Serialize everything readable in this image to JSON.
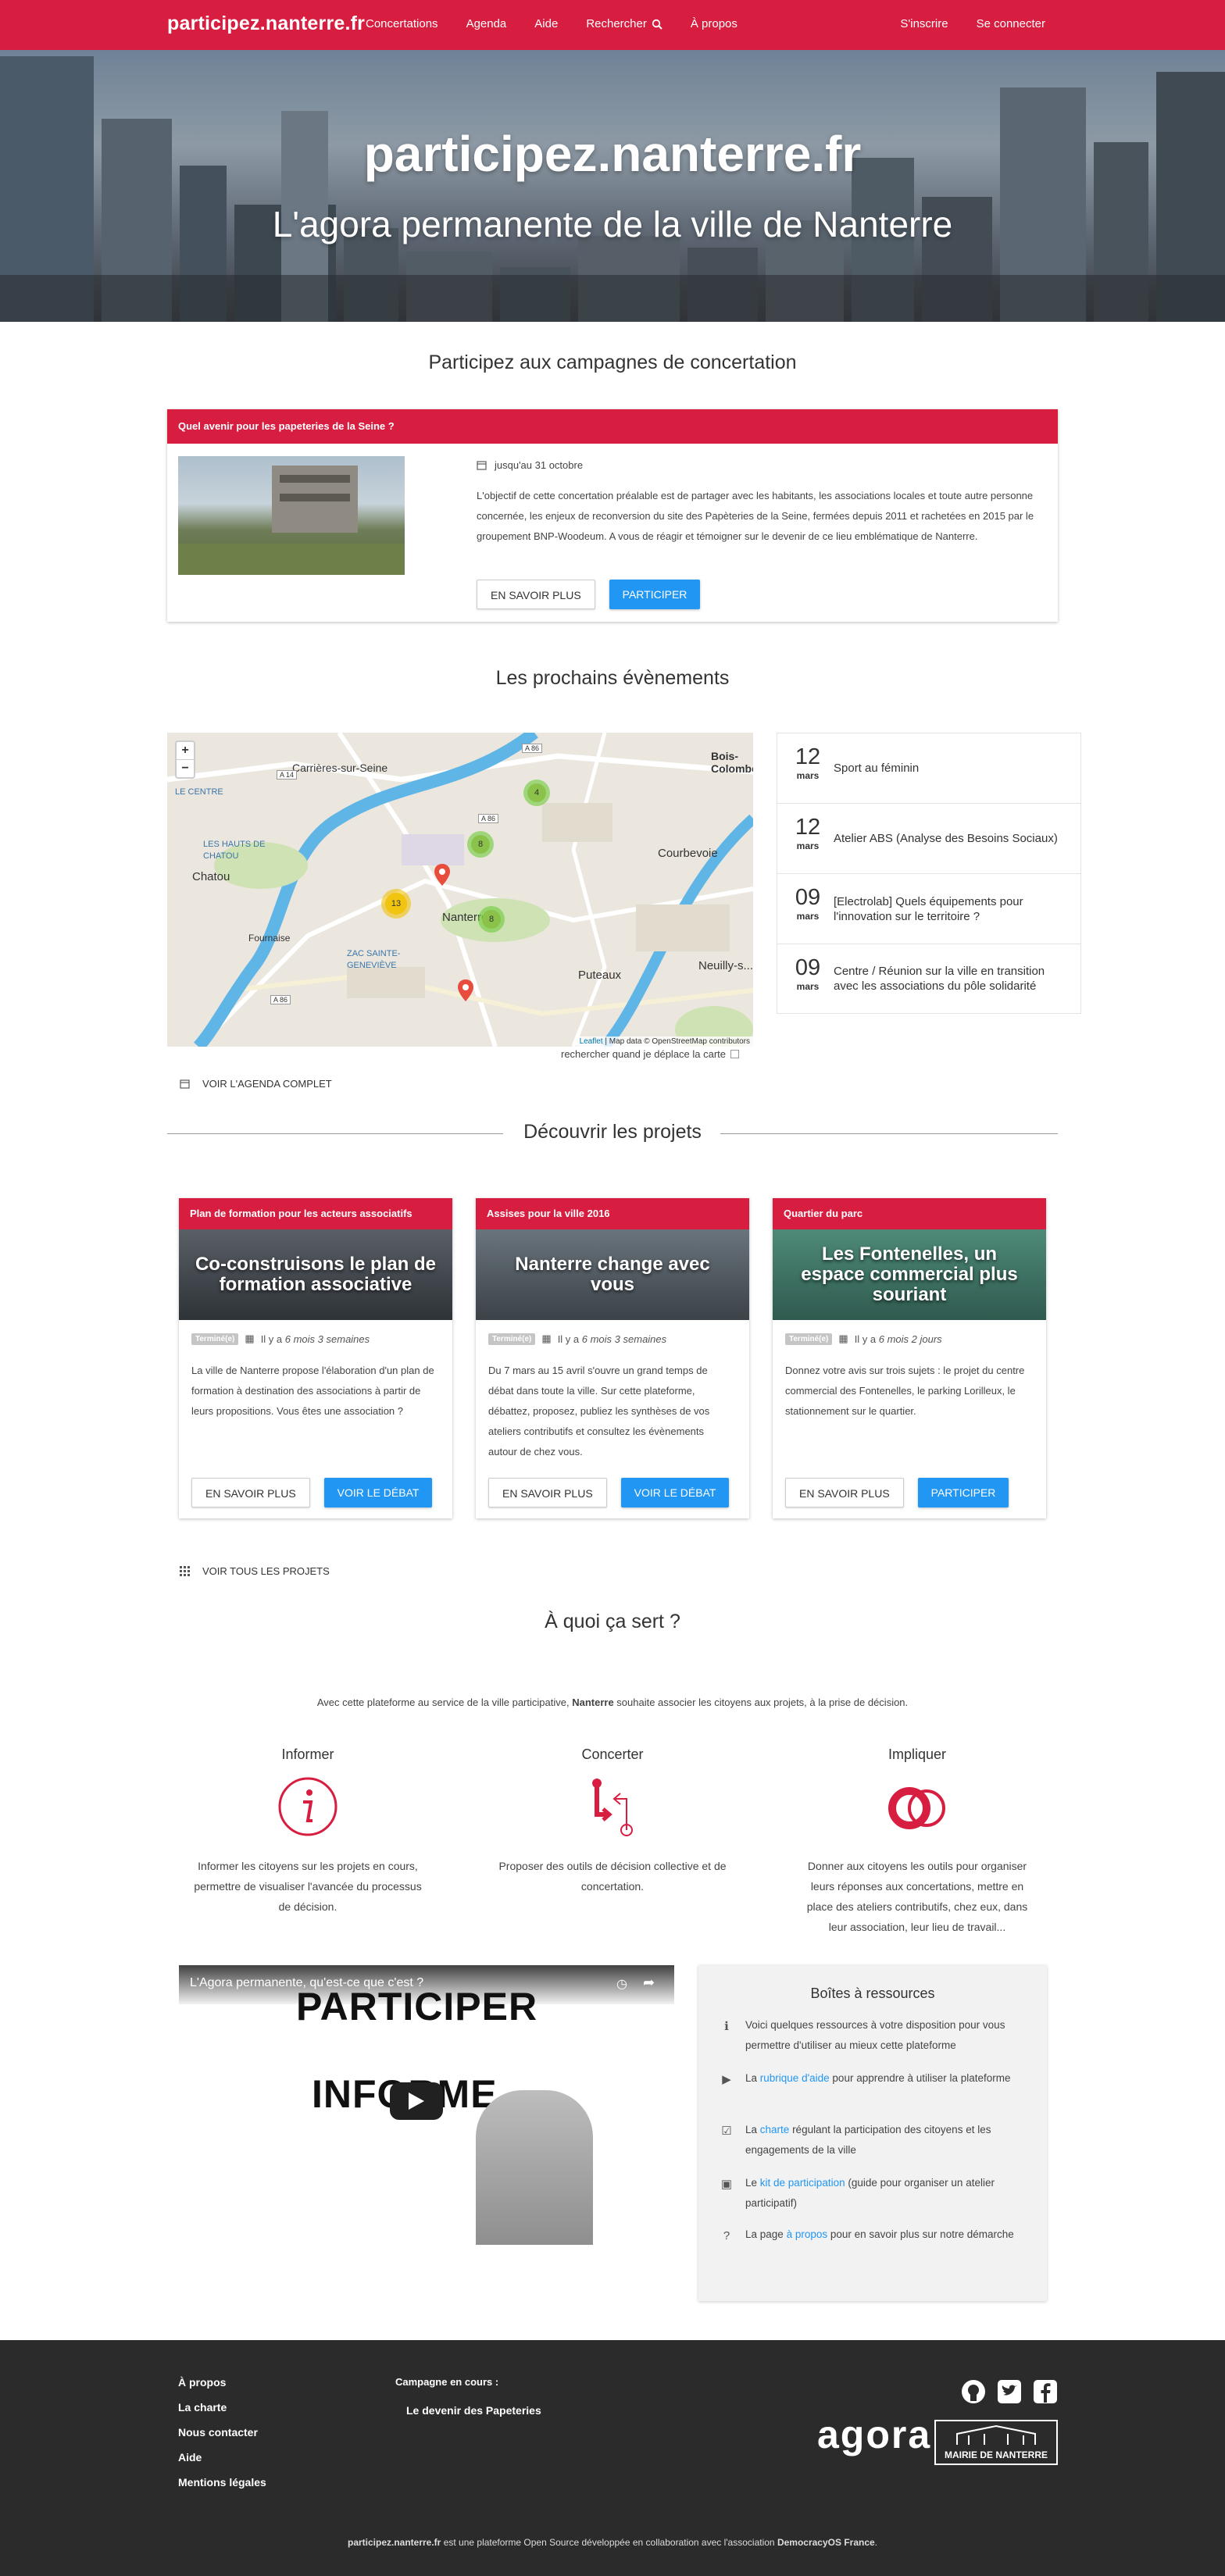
{
  "nav": {
    "brand": "participez.nanterre.fr",
    "links": [
      "Concertations",
      "Agenda",
      "Aide",
      "Rechercher",
      "À propos"
    ],
    "signup": "S'inscrire",
    "login": "Se connecter"
  },
  "hero": {
    "title": "participez.nanterre.fr",
    "subtitle": "L'agora permanente de la ville de Nanterre"
  },
  "campaigns": {
    "title": "Participez aux campagnes de concertation",
    "card": {
      "header": "Quel avenir pour les papeteries de la Seine ?",
      "date": "jusqu'au 31 octobre",
      "text": "L'objectif de cette concertation préalable est de partager avec les habitants, les associations locales et toute autre personne concernée, les enjeux de reconversion du site des Papèteries de la Seine, fermées depuis 2011 et rachetées en 2015 par le groupement BNP-Woodeum. A vous de réagir et témoigner sur le devenir de ce lieu emblématique de Nanterre.",
      "more": "EN SAVOIR PLUS",
      "participate": "PARTICIPER"
    }
  },
  "events": {
    "title": "Les prochains évènements",
    "map": {
      "zoom_in": "+",
      "zoom_out": "−",
      "places": [
        "Carrières-sur-Seine",
        "Bois-Colombes",
        "LE CENTRE",
        "LES HAUTS DE CHATOU",
        "Chatou",
        "Fournaise",
        "ZAC SAINTE-GENEVIÈVE",
        "Nanterre",
        "Courbevoie",
        "Puteaux",
        "Neuilly-s..."
      ],
      "roads": [
        "A 86",
        "A 14",
        "A 86",
        "A 86"
      ],
      "clusters": [
        "4",
        "8",
        "13",
        "8"
      ],
      "attribution_leaflet": "Leaflet",
      "attribution_rest": " | Map data © OpenStreetMap contributors",
      "search_label": "rechercher quand je déplace la carte"
    },
    "items": [
      {
        "day": "12",
        "month": "mars",
        "title": "Sport au féminin"
      },
      {
        "day": "12",
        "month": "mars",
        "title": "Atelier ABS (Analyse des Besoins Sociaux)"
      },
      {
        "day": "09",
        "month": "mars",
        "title": "[Electrolab] Quels équipements pour l'innovation sur le territoire ?"
      },
      {
        "day": "09",
        "month": "mars",
        "title": "Centre / Réunion sur la ville en transition avec les associations du pôle solidarité"
      }
    ],
    "agenda_link": "VOIR L'AGENDA COMPLET"
  },
  "projects": {
    "title": "Découvrir les projets",
    "cards": [
      {
        "header": "Plan de formation pour les acteurs associatifs",
        "image_title": "Co-construisons le plan de formation associative",
        "badge": "Terminé(e)",
        "time_prefix": "Il y a ",
        "time": "6 mois 3 semaines",
        "text": "La ville de Nanterre propose l'élaboration d'un plan de formation à destination des associations à partir de leurs propositions. Vous êtes une association ?",
        "more": "EN SAVOIR PLUS",
        "action": "VOIR LE DÉBAT"
      },
      {
        "header": "Assises pour la ville 2016",
        "image_title": "Nanterre change avec vous",
        "badge": "Terminé(e)",
        "time_prefix": "Il y a ",
        "time": "6 mois 3 semaines",
        "text": "Du 7 mars au 15 avril s'ouvre un grand temps de débat dans toute la ville. Sur cette plateforme, débattez, proposez, publiez les synthèses de vos ateliers contributifs et consultez les évènements autour de chez vous.",
        "more": "EN SAVOIR PLUS",
        "action": "VOIR LE DÉBAT"
      },
      {
        "header": "Quartier du parc",
        "image_title": "Les Fontenelles, un espace commercial plus souriant",
        "badge": "Terminé(e)",
        "time_prefix": "Il y a ",
        "time": "6 mois 2 jours",
        "text": "Donnez votre avis sur trois sujets : le projet du centre commercial des Fontenelles, le parking Lorilleux, le stationnement sur le quartier.",
        "more": "EN SAVOIR PLUS",
        "action": "PARTICIPER"
      }
    ],
    "all_link": "VOIR TOUS LES PROJETS"
  },
  "purpose": {
    "title": "À quoi ça sert ?",
    "intro_before": "Avec cette plateforme au service de la ville participative, ",
    "intro_bold": "Nanterre",
    "intro_after": " souhaite associer les citoyens aux projets, à la prise de décision.",
    "pillars": [
      {
        "title": "Informer",
        "text": "Informer les citoyens sur les projets en cours, permettre de visualiser l'avancée du processus de décision."
      },
      {
        "title": "Concerter",
        "text": "Proposer des outils de décision collective et de concertation."
      },
      {
        "title": "Impliquer",
        "text": "Donner aux citoyens les outils pour organiser leurs réponses aux concertations, mettre en place des ateliers contributifs, chez eux, dans leur association, leur lieu de travail..."
      }
    ]
  },
  "video": {
    "title": "L'Agora permanente, qu'est-ce que c'est ?",
    "board_line1": "PARTICIPER",
    "board_line2": "INFORME"
  },
  "resources": {
    "title": "Boîtes à ressources",
    "intro": "Voici quelques ressources à votre disposition pour vous permettre d'utiliser au mieux cette plateforme",
    "items": [
      {
        "before": "La ",
        "link": "rubrique d'aide",
        "after": " pour apprendre à utiliser la plateforme"
      },
      {
        "before": "La ",
        "link": "charte",
        "after": " régulant la participation des citoyens et les engagements de la ville"
      },
      {
        "before": "Le ",
        "link": "kit de participation",
        "after": " (guide pour organiser un atelier participatif)"
      },
      {
        "before": "La page ",
        "link": "à propos",
        "after": " pour en savoir plus sur notre démarche"
      }
    ]
  },
  "footer": {
    "links": [
      "À propos",
      "La charte",
      "Nous contacter",
      "Aide",
      "Mentions légales"
    ],
    "campaign_label": "Campagne en cours :",
    "campaign_link": "Le devenir des Papeteries",
    "agora_logo": "agora",
    "mairie_logo": "MAIRIE DE NANTERRE",
    "bottom_brand": "participez.nanterre.fr",
    "bottom_mid": " est une plateforme Open Source développée en collaboration avec l'association ",
    "bottom_org": "DemocracyOS France",
    "bottom_end": "."
  },
  "colors": {
    "brand": "#d81e40",
    "button": "#2196f3",
    "footer": "#2b2b2b"
  }
}
